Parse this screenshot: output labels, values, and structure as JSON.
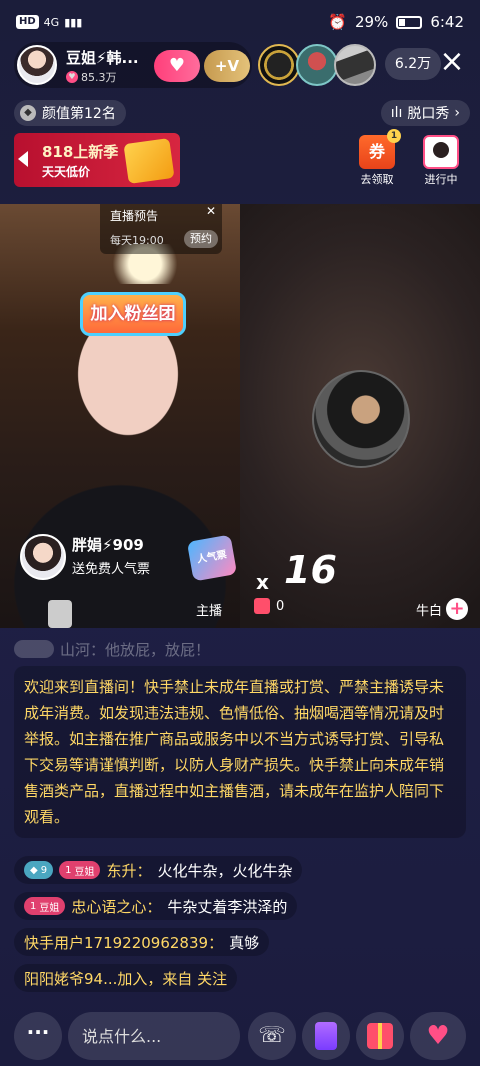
{
  "statusbar": {
    "left_chips": [
      "HD",
      "4G",
      "▮▮▮"
    ],
    "battery": "29%",
    "time": "6:42"
  },
  "host": {
    "name": "豆姐⚡韩...",
    "likes": "85.3万",
    "follow_icon": "plus-heart-icon",
    "vip_label": "+V"
  },
  "viewers": {
    "count": "6.2万"
  },
  "rank": {
    "label": "颜值第12名",
    "category": "脱口秀",
    "category_arrow": "›"
  },
  "promo": {
    "line1": "818上新季",
    "line2": "天天低价"
  },
  "coupon": {
    "icon_text": "券",
    "badge": "1",
    "label": "去领取"
  },
  "ongoing": {
    "label": "进行中"
  },
  "video": {
    "preview_title": "直播预告",
    "preview_time": "每天19:00",
    "reserve": "预约",
    "fan_badge": "加入粉丝团",
    "guest_name": "胖娟⚡909",
    "guest_sub": "送免费人气票",
    "popular_badge": "人气票",
    "host_label": "主播",
    "pk_x": "x",
    "pk_count": "16",
    "gift_count": "0",
    "guest2_name": "牛白"
  },
  "chat": {
    "faded": "山河：他放屁，放屁！",
    "notice": "欢迎来到直播间！快手禁止未成年直播或打赏、严禁主播诱导未成年消费。如发现违法违规、色情低俗、抽烟喝酒等情况请及时举报。如主播在推广商品或服务中以不当方式诱导打赏、引导私下交易等请谨慎判断，以防人身财产损失。快手禁止向未成年销售酒类产品，直播过程中如主播售酒，请未成年在监护人陪同下观看。",
    "messages": [
      {
        "badges": [
          {
            "type": "blue",
            "text": "9"
          },
          {
            "type": "pink",
            "text": "豆姐",
            "num": "1"
          }
        ],
        "user": "东升：",
        "text": "火化牛杂，火化牛杂"
      },
      {
        "badges": [
          {
            "type": "pink",
            "text": "豆姐",
            "num": "1"
          }
        ],
        "user": "忠心语之心：",
        "text": "牛杂丈着李洪泽的"
      },
      {
        "badges": [],
        "user": "快手用户1719220962839：",
        "text": "真够"
      },
      {
        "badges": [],
        "user": "阳阳姥爷94...加入，来自 关注",
        "text": ""
      }
    ]
  },
  "bottombar": {
    "more": "···",
    "input_placeholder": "说点什么...",
    "call_icon": "phone-icon",
    "card_icon": "card-icon",
    "gift_icon": "gift-icon",
    "like_icon": "heart-plus-icon"
  }
}
